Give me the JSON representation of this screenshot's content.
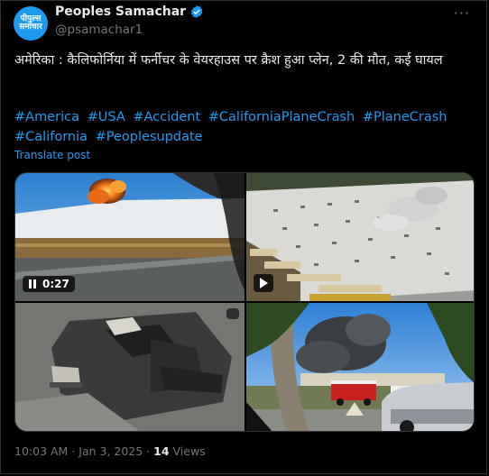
{
  "author": {
    "display_name": "Peoples Samachar",
    "handle": "@psamachar1",
    "avatar_text_line1": "पीपुल्स",
    "avatar_text_line2": "समाचार"
  },
  "tweet": {
    "text": "अमेरिका : कैलिफोर्निया में फर्नीचर के वेयरहाउस पर क्रैश हुआ प्लेन, 2 की मौत, कई घायल",
    "hashtags": [
      "#America",
      "#USA",
      "#Accident",
      "#CaliforniaPlaneCrash",
      "#PlaneCrash",
      "#California",
      "#Peoplesupdate"
    ],
    "translate_label": "Translate post"
  },
  "media": {
    "video_duration": "0:27"
  },
  "meta": {
    "timestamp": "10:03 AM · Jan 3, 2025 · ",
    "views_count": "14",
    "views_label": " Views"
  },
  "colors": {
    "accent": "#1d9bf0",
    "muted": "#71767b",
    "text": "#e7e9ea",
    "background": "#000000"
  },
  "icons": [
    "verified-badge-icon",
    "more-options-icon",
    "pause-icon",
    "play-icon",
    "gif-icon"
  ]
}
